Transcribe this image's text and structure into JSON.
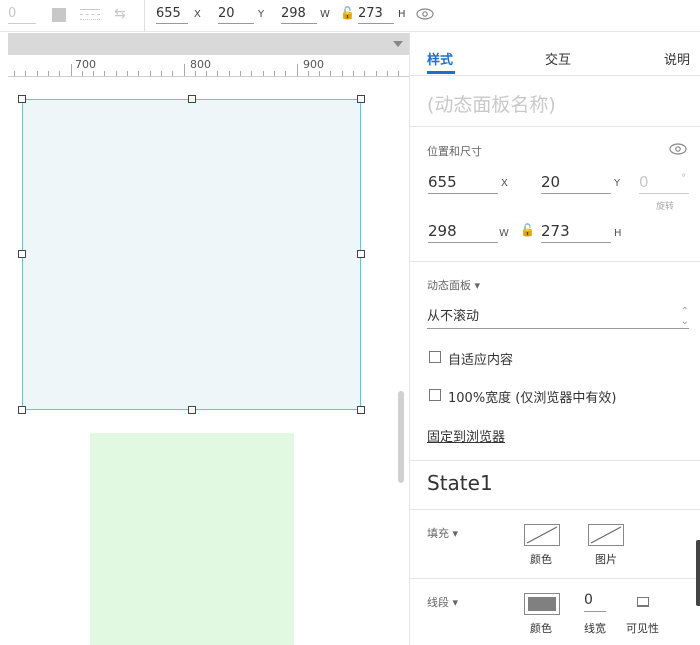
{
  "toolbar": {
    "rotation": "0",
    "x": "655",
    "x_unit": "X",
    "y": "20",
    "y_unit": "Y",
    "w": "298",
    "w_unit": "W",
    "h": "273",
    "h_unit": "H"
  },
  "ruler": {
    "labels": [
      "700",
      "800",
      "900"
    ]
  },
  "inspector": {
    "tabs": {
      "style": "样式",
      "interaction": "交互",
      "notes": "说明"
    },
    "panel_name_placeholder": "(动态面板名称)",
    "position_size": {
      "title": "位置和尺寸",
      "x": "655",
      "x_unit": "X",
      "y": "20",
      "y_unit": "Y",
      "rotation": "0",
      "rotation_unit": "°",
      "rotation_label": "旋转",
      "w": "298",
      "w_unit": "W",
      "h": "273",
      "h_unit": "H"
    },
    "dynamic_panel": {
      "title": "动态面板 ▾",
      "scroll_value": "从不滚动",
      "fit_content": "自适应内容",
      "full_width": "100%宽度 (仅浏览器中有效)",
      "pin_to_browser": "固定到浏览器"
    },
    "state_name": "State1",
    "fill": {
      "title": "填充 ▾",
      "color_label": "颜色",
      "image_label": "图片"
    },
    "stroke": {
      "title": "线段 ▾",
      "color_label": "颜色",
      "width_value": "0",
      "width_label": "线宽",
      "visible_label": "可见性"
    }
  },
  "colors": {
    "accent": "#1d6fcf",
    "selection_border": "#3ed6d6",
    "panel_fill": "#eef6f9",
    "green_fill": "#e0f9e0",
    "stroke_swatch": "#808080"
  }
}
